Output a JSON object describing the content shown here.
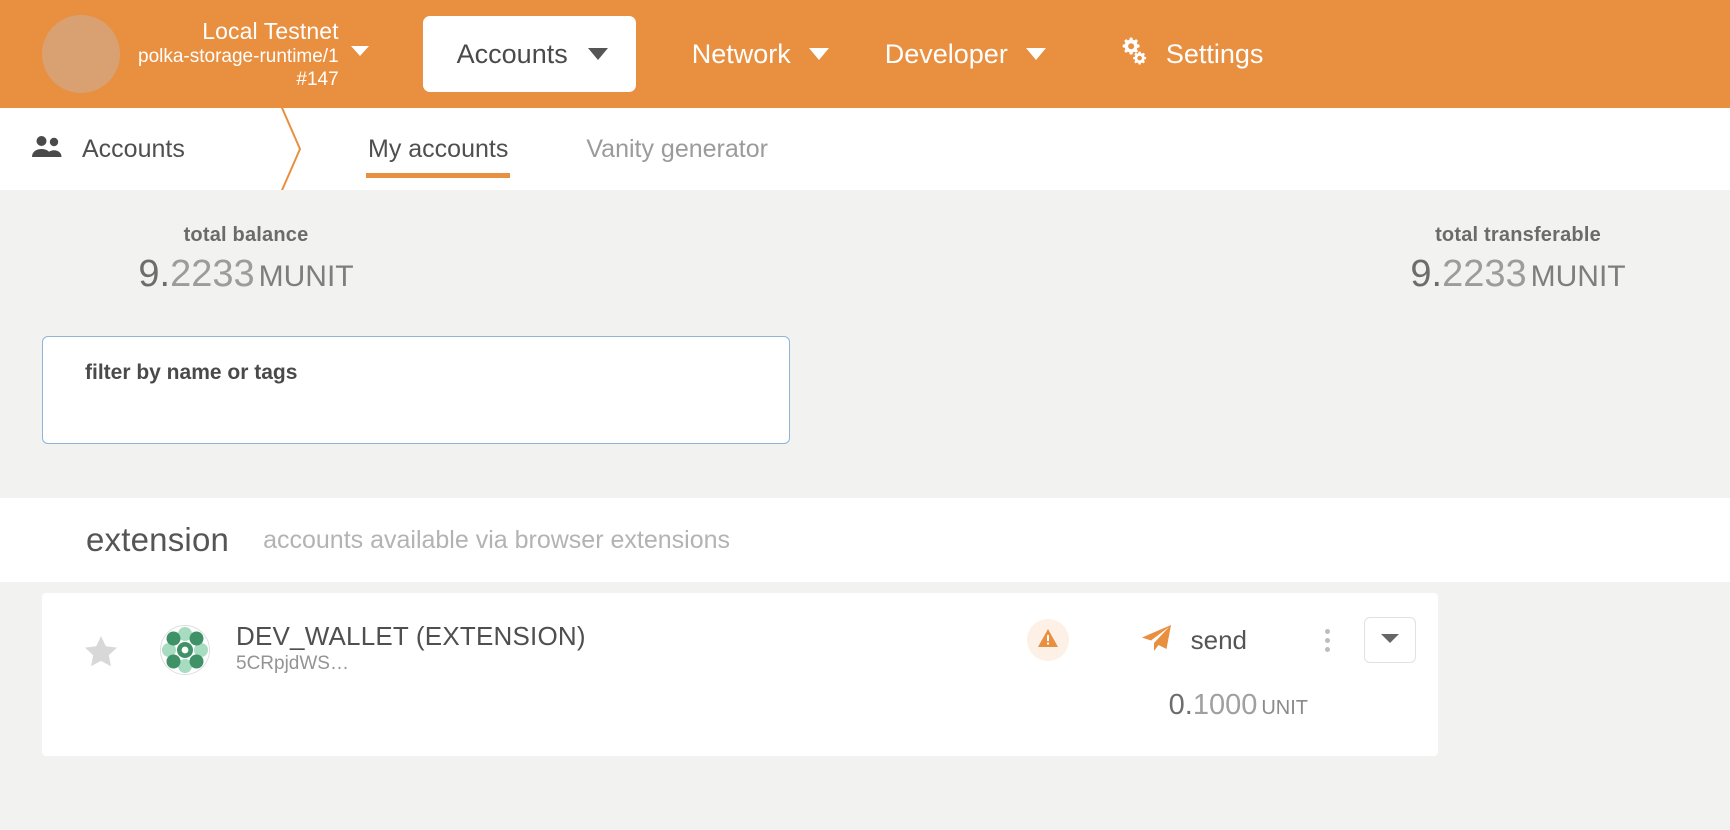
{
  "topbar": {
    "chain": {
      "name": "Local Testnet",
      "runtime": "polka-storage-runtime/1",
      "block": "#147"
    },
    "primary_nav": {
      "label": "Accounts"
    },
    "nav_items": [
      {
        "label": "Network"
      },
      {
        "label": "Developer"
      }
    ],
    "settings": {
      "label": "Settings"
    }
  },
  "breadcrumb": {
    "label": "Accounts"
  },
  "tabs": [
    {
      "label": "My accounts",
      "active": true
    },
    {
      "label": "Vanity generator",
      "active": false
    }
  ],
  "summary": {
    "total_balance": {
      "label": "total balance",
      "int": "9.",
      "dec": "2233",
      "unit": "MUNIT"
    },
    "total_transferable": {
      "label": "total transferable",
      "int": "9.",
      "dec": "2233",
      "unit": "MUNIT"
    }
  },
  "filter": {
    "placeholder": "filter by name or tags",
    "value": ""
  },
  "extension_section": {
    "title": "extension",
    "subtitle": "accounts available via browser extensions"
  },
  "account": {
    "name": "DEV_WALLET (EXTENSION)",
    "address": "5CRpjdWS…",
    "send_label": "send",
    "balance": {
      "int": "0.",
      "dec": "1000",
      "unit": "UNIT"
    }
  },
  "colors": {
    "brand_orange": "#e98f40",
    "page_bg": "#f2f2f0",
    "panel_bg": "#ffffff",
    "focus_border": "#8fb4d6",
    "identicon_green": "#3f9268"
  }
}
